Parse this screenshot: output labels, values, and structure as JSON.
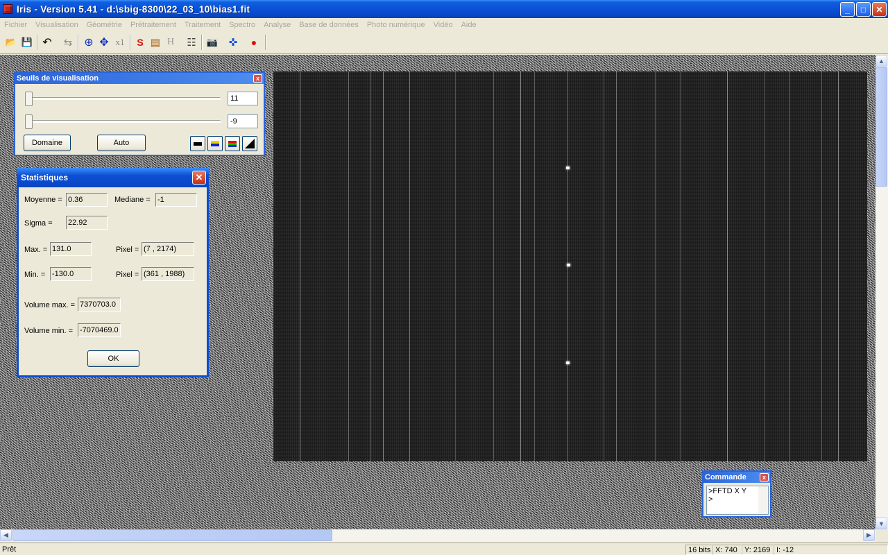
{
  "window": {
    "title": "Iris - Version 5.41 - d:\\sbig-8300\\22_03_10\\bias1.fit",
    "minimize_glyph": "_",
    "maximize_glyph": "□",
    "close_glyph": "✕"
  },
  "menu": [
    "Fichier",
    "Visualisation",
    "Géométrie",
    "Prétraitement",
    "Traitement",
    "Spectro",
    "Analyse",
    "Base de données",
    "Photo numérique",
    "Vidéo",
    "Aide"
  ],
  "toolbar": {
    "open_glyph": "📂",
    "save_glyph": "💾",
    "undo_glyph": "↶",
    "swap_glyph": "⇆",
    "zoom_in_glyph": "⊕",
    "move_glyph": "✥",
    "x1_label": "x1",
    "s_glyph": "S",
    "frame_glyph": "▤",
    "h_label": "H",
    "list_glyph": "☷",
    "camera_glyph": "📷",
    "arrows_glyph": "✜",
    "record_glyph": "●"
  },
  "seuils": {
    "title": "Seuils de visualisation",
    "close_glyph": "x",
    "high_value": "11",
    "low_value": "-9",
    "domain_button": "Domaine",
    "auto_button": "Auto"
  },
  "stats": {
    "title": "Statistiques",
    "close_glyph": "✕",
    "mean_label": "Moyenne =",
    "mean_value": "0.36",
    "median_label": "Mediane =",
    "median_value": "-1",
    "sigma_label": "Sigma =",
    "sigma_value": "22.92",
    "max_label": "Max. =",
    "max_value": "131.0",
    "max_pixel_label": "Pixel =",
    "max_pixel_value": "(7 , 2174)",
    "min_label": "Min. =",
    "min_value": "-130.0",
    "min_pixel_label": "Pixel =",
    "min_pixel_value": "(361 , 1988)",
    "vol_max_label": "Volume max. =",
    "vol_max_value": "7370703.0",
    "vol_min_label": "Volume min. =",
    "vol_min_value": "-7070469.0",
    "ok_button": "OK"
  },
  "commande": {
    "title": "Commande",
    "close_glyph": "x",
    "line1": ">FFTD X Y",
    "line2": ">"
  },
  "status": {
    "ready": "Prêt",
    "bits": "16 bits",
    "x": "X: 740",
    "y": "Y: 2169",
    "i": "I: -12"
  },
  "scroll": {
    "up": "▲",
    "down": "▼",
    "left": "◀",
    "right": "▶"
  }
}
